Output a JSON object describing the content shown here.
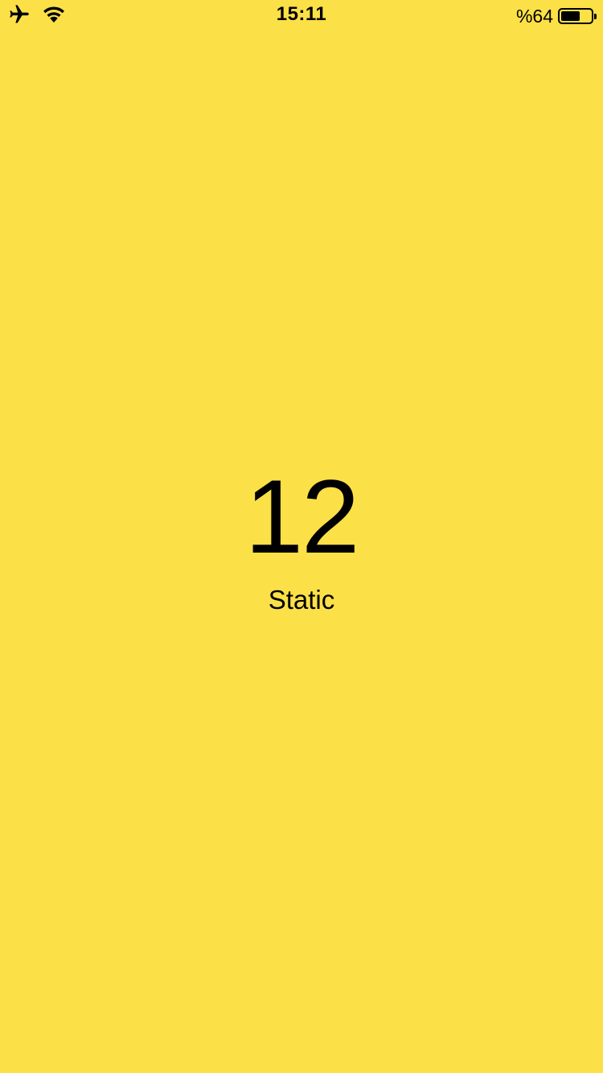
{
  "status_bar": {
    "left_icons": [
      "airplane-icon",
      "wifi-icon"
    ],
    "time": "15:11",
    "battery_percent_text": "%64",
    "battery_level": 0.64
  },
  "main": {
    "value": "12",
    "label": "Static"
  },
  "colors": {
    "background": "#FBE047",
    "text": "#000000"
  }
}
